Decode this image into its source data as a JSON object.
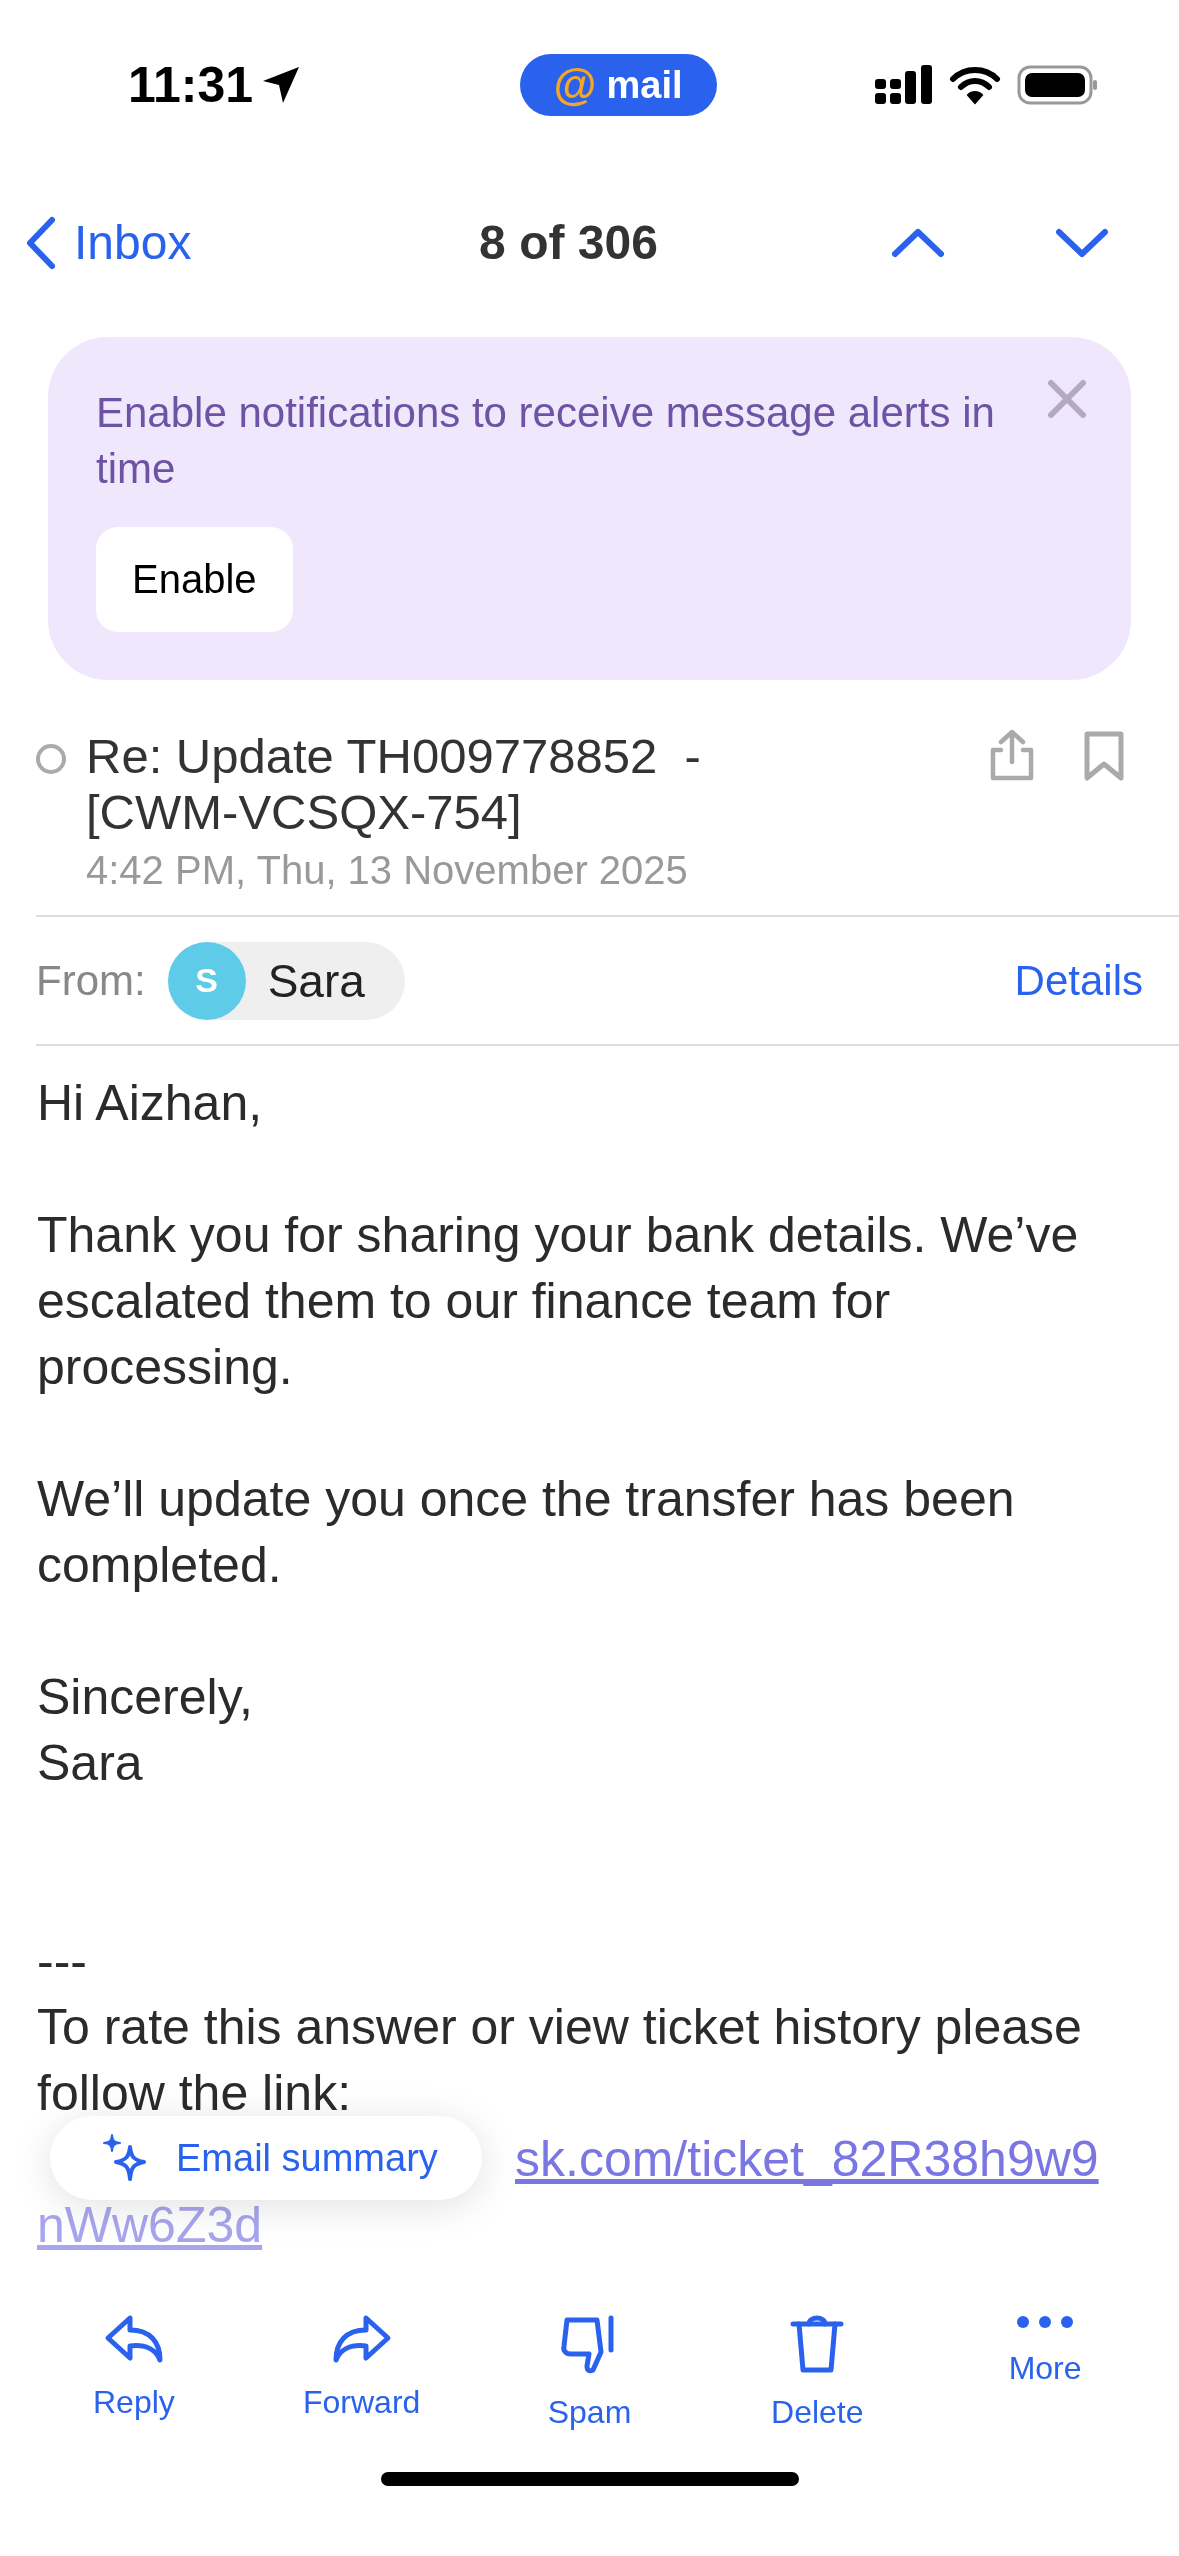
{
  "status_bar": {
    "time": "11:31",
    "app_badge": {
      "mark": "@",
      "label": "mail"
    }
  },
  "nav": {
    "back_label": "Inbox",
    "position": "8 of 306"
  },
  "banner": {
    "text": "Enable notifications to receive message alerts in time",
    "button": "Enable"
  },
  "message": {
    "unread": false,
    "bookmarked": false,
    "subject": "Re: Update TH009778852  - [CWM-VCSQX-754]",
    "date": "4:42 PM, Thu, 13 November 2025",
    "from_label": "From:",
    "sender": {
      "initial": "S",
      "name": "Sara",
      "color": "#5ecbe8"
    },
    "details": "Details",
    "body": [
      [
        "Hi Aizhan,"
      ],
      [
        "Thank you for sharing your bank details. We’ve escalated them to our finance team for processing."
      ],
      [
        "We’ll update you once the transfer has been completed."
      ],
      [
        "Sincerely,",
        "Sara"
      ]
    ],
    "separator": "---",
    "footer": "To rate this answer or view ticket history please follow the link:",
    "link": {
      "line_1_end": "sk.com/ticket_82R38h9w9",
      "line_2": "nWw6Z3d"
    }
  },
  "summary_button": "Email summary",
  "toolbar": [
    {
      "kind": "reply",
      "label": "Reply"
    },
    {
      "kind": "forward",
      "label": "Forward"
    },
    {
      "kind": "spam",
      "label": "Spam"
    },
    {
      "kind": "delete",
      "label": "Delete"
    },
    {
      "kind": "more",
      "label": "More"
    }
  ]
}
